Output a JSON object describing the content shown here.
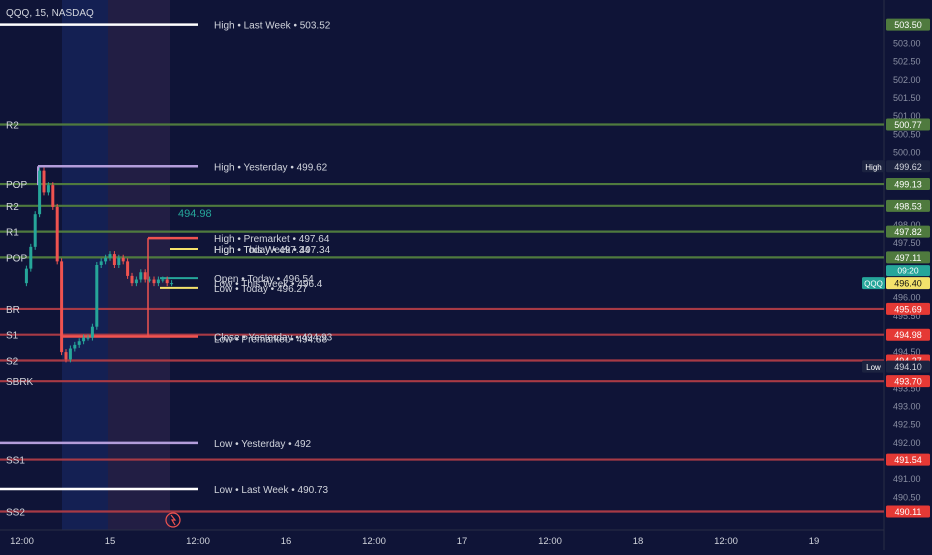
{
  "header": {
    "symbol_line": "QQQ, 15, NASDAQ"
  },
  "axis": {
    "ylim": [
      489.6,
      504.2
    ],
    "ticks": [
      "503.00",
      "502.50",
      "502.00",
      "501.50",
      "501.00",
      "500.50",
      "500.00",
      "498.00",
      "497.50",
      "496.00",
      "495.50",
      "494.50",
      "493.50",
      "493.00",
      "492.50",
      "492.00",
      "491.00",
      "490.50"
    ],
    "x_labels": [
      {
        "label": "12:00",
        "t": 0
      },
      {
        "label": "15",
        "t": 1
      },
      {
        "label": "12:00",
        "t": 2
      },
      {
        "label": "16",
        "t": 3
      },
      {
        "label": "12:00",
        "t": 4
      },
      {
        "label": "17",
        "t": 5
      },
      {
        "label": "12:00",
        "t": 6
      },
      {
        "label": "18",
        "t": 7
      },
      {
        "label": "12:00",
        "t": 8
      },
      {
        "label": "19",
        "t": 9
      }
    ]
  },
  "colors": {
    "bg": "#0f1437",
    "up": "#26a69a",
    "down": "#ef5350",
    "green_line": "#4f7a3e",
    "red_line": "#a83a45",
    "white": "#ffffff",
    "lavender": "#b39ddb",
    "yellow": "#f4e26b",
    "teal_label": "#26a69a"
  },
  "pivot_levels": [
    {
      "label": "R2",
      "value": 500.77,
      "color": "#4f7a3e"
    },
    {
      "label": "POP",
      "value": 499.13,
      "color": "#4f7a3e"
    },
    {
      "label": "R2",
      "value": 498.53,
      "color": "#4f7a3e"
    },
    {
      "label": "R1",
      "value": 497.82,
      "color": "#4f7a3e"
    },
    {
      "label": "POP",
      "value": 497.11,
      "color": "#4f7a3e"
    },
    {
      "label": "BR",
      "value": 495.69,
      "color": "#a83a45"
    },
    {
      "label": "S1",
      "value": 494.98,
      "color": "#a83a45"
    },
    {
      "label": "S2",
      "value": 494.27,
      "color": "#a83a45"
    },
    {
      "label": "SBRK",
      "value": 493.7,
      "color": "#a83a45"
    },
    {
      "label": "SS1",
      "value": 491.54,
      "color": "#a83a45"
    },
    {
      "label": "SS2",
      "value": 490.11,
      "color": "#a83a45"
    }
  ],
  "level_labels": [
    {
      "text": "High • Last Week • 503.52",
      "value": 503.52
    },
    {
      "text": "High • Yesterday • 499.62",
      "value": 499.62
    },
    {
      "text": "High • Premarket • 497.64",
      "value": 497.64
    },
    {
      "text": "High • Today • 497.34",
      "value": 497.34
    },
    {
      "text": "High • This Week • 497.34",
      "value": 497.34
    },
    {
      "text": "Open • Today • 496.54",
      "value": 496.54
    },
    {
      "text": "Low • This Week • 496.4",
      "value": 496.4
    },
    {
      "text": "Low • Today • 496.27",
      "value": 496.27
    },
    {
      "text": "Close • Yesterday • 494.93",
      "value": 494.93
    },
    {
      "text": "Low • Premarket • 494.88",
      "value": 494.88
    },
    {
      "text": "Low • Yesterday • 492",
      "value": 492
    },
    {
      "text": "Low • Last Week • 490.73",
      "value": 490.73
    }
  ],
  "price_badges": [
    {
      "text": "503.50",
      "value": 503.52,
      "bg": "#4f7a3e",
      "fg": "#ffffff"
    },
    {
      "text": "500.77",
      "value": 500.77,
      "bg": "#4f7a3e",
      "fg": "#ffffff"
    },
    {
      "text": "499.62",
      "value": 499.62,
      "bg": "#1c2340",
      "fg": "#d1d4dc",
      "tag": "High"
    },
    {
      "text": "499.13",
      "value": 499.13,
      "bg": "#4f7a3e",
      "fg": "#ffffff"
    },
    {
      "text": "498.53",
      "value": 498.53,
      "bg": "#4f7a3e",
      "fg": "#ffffff"
    },
    {
      "text": "497.82",
      "value": 497.82,
      "bg": "#4f7a3e",
      "fg": "#ffffff"
    },
    {
      "text": "497.11",
      "value": 497.11,
      "bg": "#4f7a3e",
      "fg": "#ffffff"
    },
    {
      "text": "496.40",
      "value": 496.4,
      "bg": "#f4e26b",
      "fg": "#111111",
      "tag": "QQQ",
      "tag2": "09:20"
    },
    {
      "text": "495.69",
      "value": 495.69,
      "bg": "#e53935",
      "fg": "#ffffff"
    },
    {
      "text": "494.98",
      "value": 494.98,
      "bg": "#e53935",
      "fg": "#ffffff"
    },
    {
      "text": "494.27",
      "value": 494.27,
      "bg": "#e53935",
      "fg": "#ffffff"
    },
    {
      "text": "494.10",
      "value": 494.1,
      "bg": "#1c2340",
      "fg": "#d1d4dc",
      "tag": "Low"
    },
    {
      "text": "493.70",
      "value": 493.7,
      "bg": "#e53935",
      "fg": "#ffffff"
    },
    {
      "text": "491.54",
      "value": 491.54,
      "bg": "#e53935",
      "fg": "#ffffff"
    },
    {
      "text": "490.11",
      "value": 490.11,
      "bg": "#e53935",
      "fg": "#ffffff"
    }
  ],
  "annotation": {
    "text": "494.98",
    "value": 498.33
  },
  "chart_data": {
    "type": "line",
    "title": "QQQ, 15, NASDAQ",
    "xlabel": "",
    "ylabel": "",
    "ylim": [
      489.6,
      504.2
    ],
    "grid": false,
    "x": [
      0,
      0.05,
      0.1,
      0.15,
      0.2,
      0.25,
      0.3,
      0.35,
      0.4,
      0.45,
      0.5,
      0.55,
      0.6,
      0.65,
      0.7,
      0.75,
      0.8,
      0.85,
      0.9,
      0.95,
      1.0,
      1.05,
      1.1,
      1.15,
      1.2,
      1.25,
      1.3,
      1.35,
      1.4,
      1.45,
      1.5,
      1.55,
      1.6,
      1.65,
      1.7
    ],
    "series": [
      {
        "values": [
          496.4,
          496.8,
          497.4,
          498.3,
          499.5,
          498.9,
          499.1,
          498.5,
          497.0,
          494.5,
          494.3,
          494.6,
          494.7,
          494.8,
          494.9,
          494.9,
          495.2,
          496.9,
          497.0,
          497.1,
          497.2,
          496.9,
          497.1,
          497.0,
          496.6,
          496.4,
          496.5,
          496.7,
          496.5,
          496.5,
          496.4,
          496.5,
          496.5,
          496.4,
          496.4
        ]
      }
    ]
  }
}
